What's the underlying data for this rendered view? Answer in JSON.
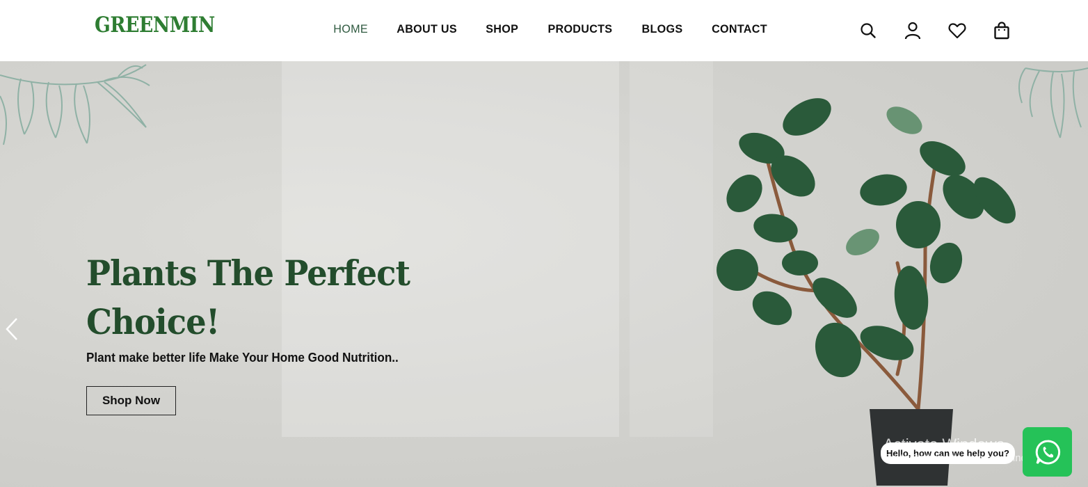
{
  "brand": {
    "logo": "GREENMIN"
  },
  "nav": {
    "items": [
      {
        "label": "HOME",
        "active": true
      },
      {
        "label": "ABOUT US"
      },
      {
        "label": "SHOP"
      },
      {
        "label": "PRODUCTS"
      },
      {
        "label": "BLOGS"
      },
      {
        "label": "CONTACT"
      }
    ]
  },
  "header_icons": [
    "search-icon",
    "user-icon",
    "heart-icon",
    "shopping-bag-icon"
  ],
  "hero": {
    "title_line1": "Plants The Perfect",
    "title_line2": "Choice!",
    "subtitle": "Plant make better life Make Your Home Good Nutrition..",
    "cta_label": "Shop Now"
  },
  "whatsapp": {
    "bubble_text": "Hello, how can we help you?"
  },
  "system_overlay": {
    "line1": "Activate Windows",
    "line2": "Go to Settings to activate Windows."
  },
  "colors": {
    "brand_green": "#2e7d32",
    "title_green": "#234d2c",
    "whatsapp_green": "#25c258"
  }
}
